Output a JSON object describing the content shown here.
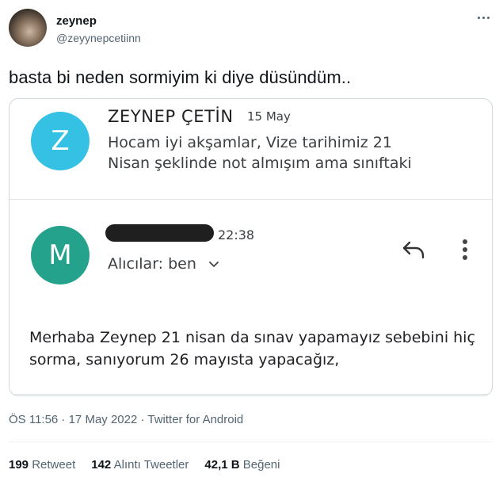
{
  "author": {
    "name": "zeynep",
    "handle": "@zeyynepcetiinn"
  },
  "tweet": {
    "text": "basta bi neden sormiyim ki diye düsündüm.."
  },
  "screenshot": {
    "first_mail": {
      "avatar_letter": "Z",
      "sender": "ZEYNEP ÇETİN",
      "date": "15 May",
      "snippet_lines": [
        "Hocam iyi akşamlar, Vize tarihimiz 21",
        "Nisan şeklinde not almışım ama sınıftaki"
      ]
    },
    "second_mail": {
      "avatar_letter": "M",
      "time": "22:38",
      "recipients": "Alıcılar: ben",
      "body_lines": [
        "Merhaba Zeynep 21 nisan da sınav yapamayız sebebini hiç",
        "sorma, sanıyorum 26 mayısta yapacağız,"
      ]
    },
    "colors": {
      "avatar_z": "#34c1e4",
      "avatar_m": "#25a28c"
    }
  },
  "meta": {
    "line": "ÖS 11:56 · 17 May 2022 · Twitter for Android"
  },
  "stats": {
    "retweets": {
      "count": "199",
      "label": "Retweet"
    },
    "quotes": {
      "count": "142",
      "label": "Alıntı Tweetler"
    },
    "likes": {
      "count": "42,1 B",
      "label": "Beğeni"
    }
  }
}
